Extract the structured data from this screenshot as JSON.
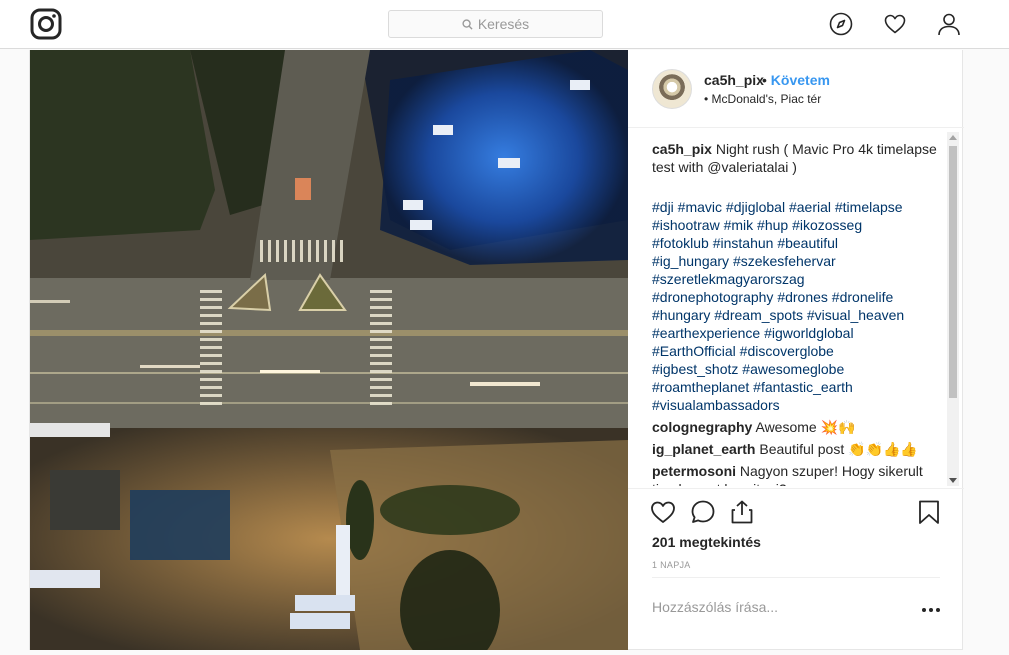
{
  "nav": {
    "logo": "instagram-logo",
    "search_placeholder": "Keresés",
    "icons": [
      "compass-icon",
      "heart-icon",
      "profile-icon"
    ]
  },
  "post": {
    "username": "ca5h_pix",
    "separator": "•",
    "follow_label": "Követem",
    "location_bullet": "•",
    "location": "McDonald's, Piac tér",
    "caption_user": "ca5h_pix",
    "caption_text": "Night rush ( Mavic Pro 4k timelapse test with @valeriatalai )",
    "hashtags": [
      "#dji #mavic #djiglobal #aerial #timelapse",
      "#ishootraw #mik #hup #ikozosseg",
      "#fotoklub #instahun #beautiful",
      "#ig_hungary #szekesfehervar",
      "#szeretlekmagyarorszag",
      "#dronephotography #drones #dronelife",
      "#hungary  #dream_spots #visual_heaven",
      "#earthexperience #igworldglobal",
      "#EarthOfficial #discoverglobe",
      "#igbest_shotz #awesomeglobe",
      "#roamtheplanet #fantastic_earth",
      "#visualambassadors"
    ],
    "comments": [
      {
        "user": "colognegraphy",
        "text": "Awesome 💥🙌"
      },
      {
        "user": "ig_planet_earth",
        "text": "Beautiful post 👏👏👍👍"
      },
      {
        "user": "petermosoni",
        "text": "Nagyon szuper! Hogy sikerult timelapse-t kesziteni?"
      }
    ],
    "views": "201 megtekintés",
    "time": "1 NAPJA",
    "add_comment_placeholder": "Hozzászólás írása..."
  },
  "colors": {
    "accent": "#3897f0",
    "hashtag": "#003569",
    "border": "#dbdbdb"
  }
}
